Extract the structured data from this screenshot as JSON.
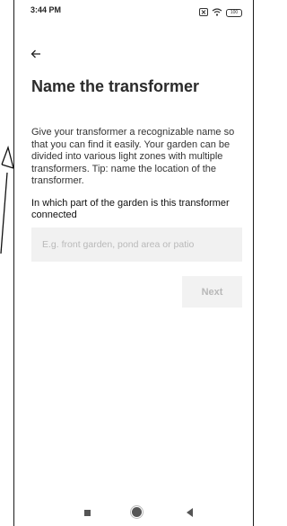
{
  "status_bar": {
    "time": "3:44 PM",
    "battery": "100"
  },
  "header": {
    "back_icon": "arrow-left-icon",
    "title": "Name the transformer"
  },
  "content": {
    "description": "Give your transformer a recognizable name so that you can find it easily. Your garden can be divided into various light zones with multiple transformers. Tip: name the location of the transformer.",
    "question": "In which part of the garden is this transformer connected",
    "input_value": "",
    "input_placeholder": "E.g. front garden, pond area or patio",
    "next_label": "Next"
  },
  "nav_bar": {
    "icons": [
      "recent-apps-icon",
      "home-icon",
      "back-icon"
    ]
  },
  "colors": {
    "text": "#2b2b2b",
    "input_bg": "#f1f1f1",
    "button_disabled_bg": "#f2f2f2",
    "button_disabled_text": "#b8b8b8"
  }
}
